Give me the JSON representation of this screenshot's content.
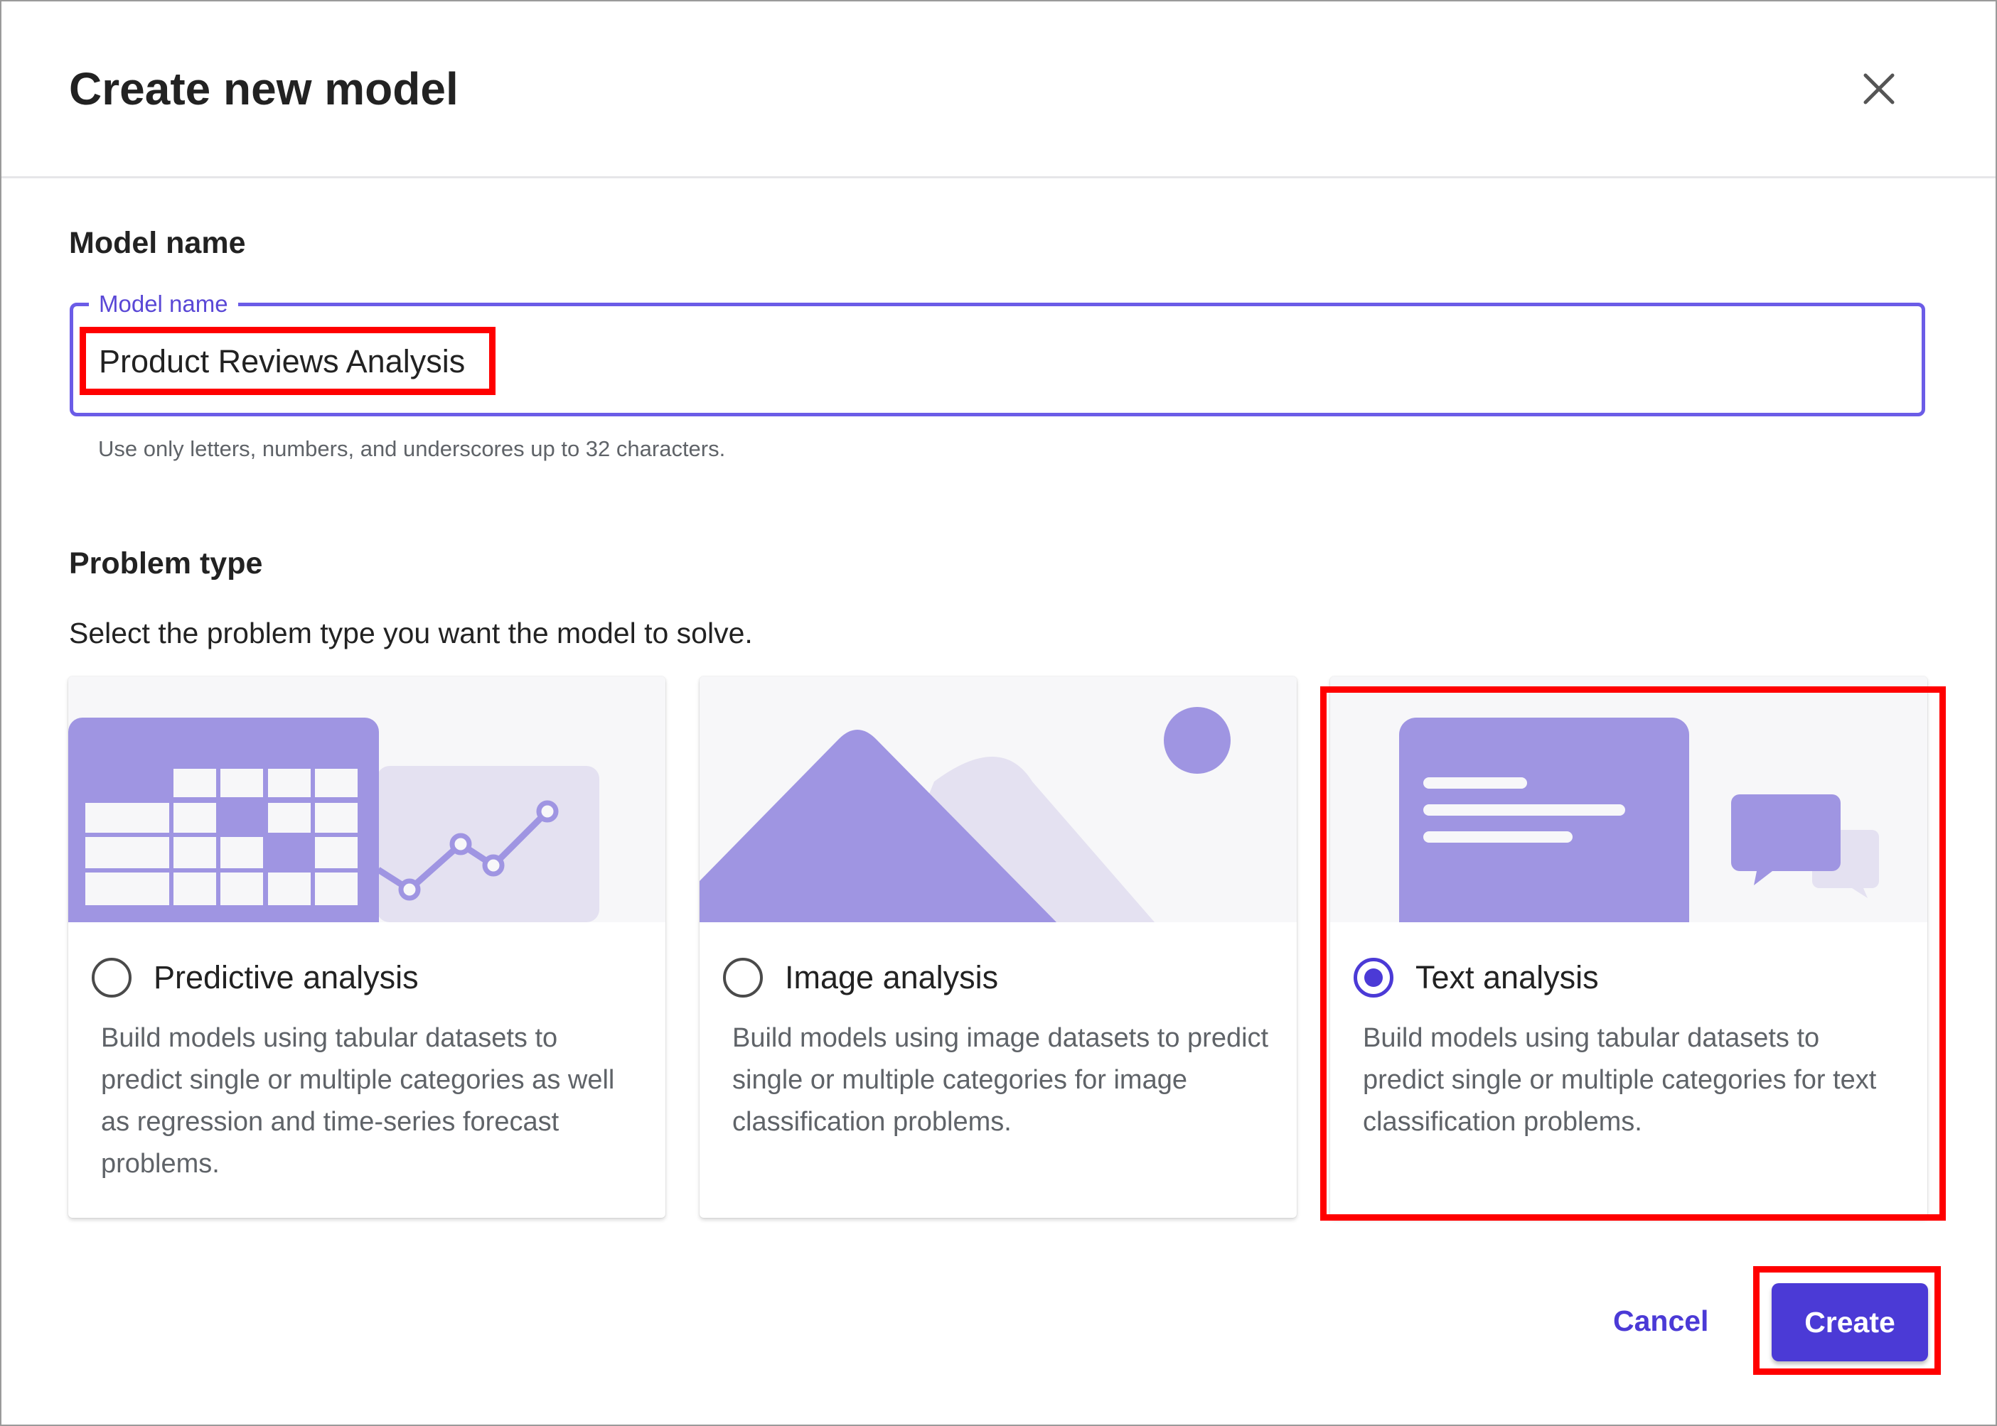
{
  "dialog": {
    "title": "Create new model",
    "close_icon": "close-icon"
  },
  "model_name": {
    "section_label": "Model name",
    "field_label": "Model name",
    "value": "Product Reviews Analysis",
    "hint": "Use only letters, numbers, and underscores up to 32 characters."
  },
  "problem_type": {
    "section_label": "Problem type",
    "description": "Select the problem type you want the model to solve.",
    "selected": "Text analysis",
    "options": [
      {
        "title": "Predictive analysis",
        "description": "Build models using tabular datasets to predict single or multiple categories as well as regression and time-series forecast problems.",
        "icon": "table-chart-illustration",
        "selected": false
      },
      {
        "title": "Image analysis",
        "description": "Build models using image datasets to predict single or multiple categories for image classification problems.",
        "icon": "mountain-image-illustration",
        "selected": false
      },
      {
        "title": "Text analysis",
        "description": "Build models using tabular datasets to predict single or multiple categories for text classification problems.",
        "icon": "text-document-illustration",
        "selected": true
      }
    ]
  },
  "footer": {
    "cancel_label": "Cancel",
    "create_label": "Create"
  },
  "colors": {
    "accent": "#4b3ad6",
    "illustration_primary": "#9f95e2",
    "illustration_light": "#e4e1f1",
    "annotation": "#ff0000"
  }
}
